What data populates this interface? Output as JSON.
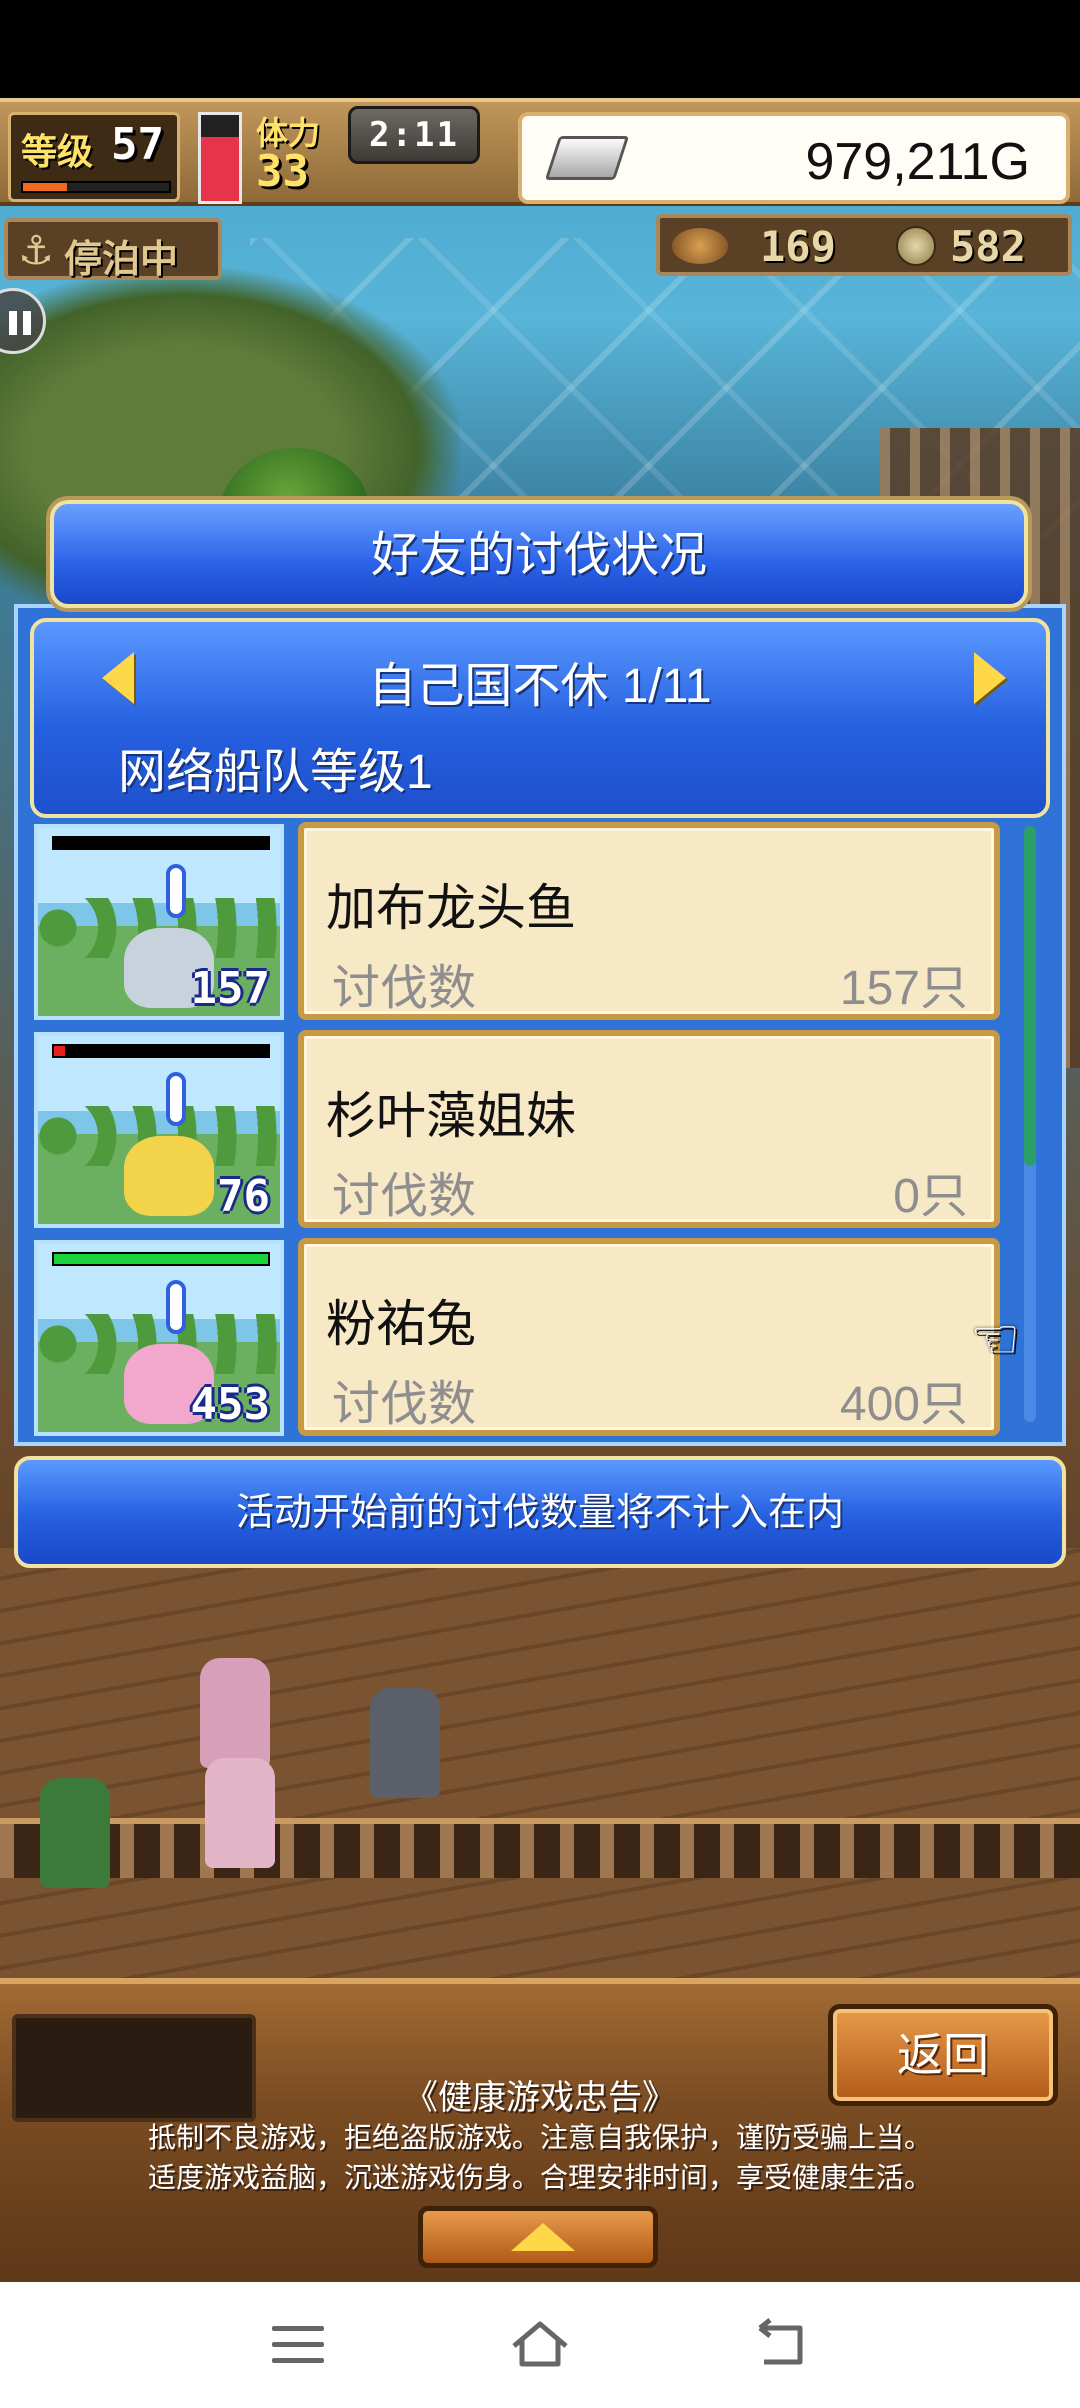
{
  "hud": {
    "level_label": "等级",
    "level_value": "57",
    "exp_fraction": 0.3,
    "stamina_label": "体力",
    "stamina_value": "33",
    "stamina_fraction": 0.75,
    "timer": "2:11",
    "gold": "979,211G",
    "status_label": "停泊中",
    "tickets": "169",
    "medals": "582"
  },
  "dialog": {
    "title": "好友的讨伐状况",
    "friend_name": "自己国不休 1/11",
    "fleet_level": "网络船队等级1",
    "notice": "活动开始前的讨伐数量将不计入在内",
    "rows": [
      {
        "name": "加布龙头鱼",
        "count_label": "讨伐数",
        "count_value": "157只",
        "badge": "157",
        "hp_fraction": 0,
        "monster_color": "#c8d2dc"
      },
      {
        "name": "杉叶藻姐妹",
        "count_label": "讨伐数",
        "count_value": "0只",
        "badge": "76",
        "hp_fraction": 0.05,
        "monster_color": "#f2d34a"
      },
      {
        "name": "粉祐兔",
        "count_label": "讨伐数",
        "count_value": "400只",
        "badge": "453",
        "hp_fraction": 1,
        "monster_color": "#f2a8cc"
      }
    ]
  },
  "bottom": {
    "back_label": "返回",
    "health_title": "《健康游戏忠告》",
    "health_line1": "抵制不良游戏，拒绝盗版游戏。注意自我保护，谨防受骗上当。",
    "health_line2": "适度游戏益脑，沉迷游戏伤身。合理安排时间，享受健康生活。"
  },
  "colors": {
    "accent_blue": "#2560e0",
    "card_bg": "#f7e8c6",
    "hp_green": "#19d33a",
    "stamina_red": "#e8344a"
  }
}
